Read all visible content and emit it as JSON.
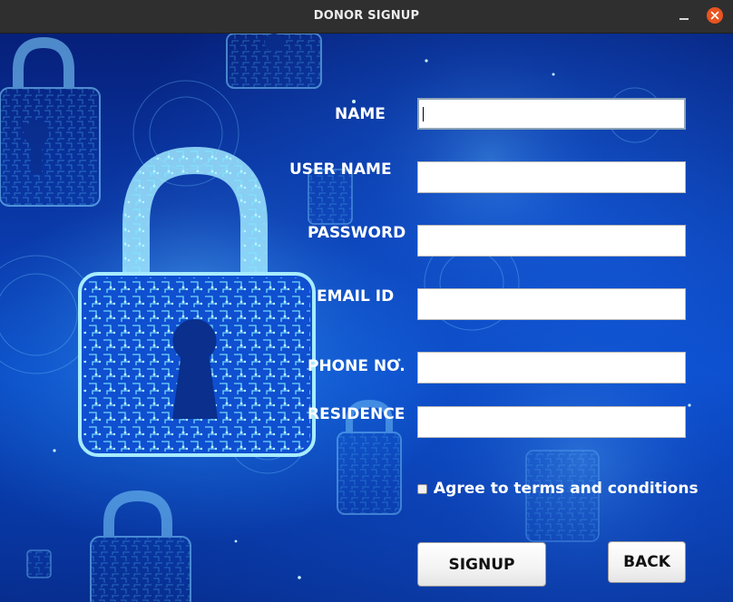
{
  "window": {
    "title": "DONOR SIGNUP"
  },
  "form": {
    "name_label": "NAME",
    "username_label": "USER NAME",
    "password_label": "PASSWORD",
    "email_label": "EMAIL ID",
    "phone_label": "PHONE NO.",
    "residence_label": "RESIDENCE",
    "name_value": "",
    "username_value": "",
    "password_value": "",
    "email_value": "",
    "phone_value": "",
    "residence_value": "",
    "agree_label": "Agree to terms and conditions",
    "agree_checked": false
  },
  "buttons": {
    "signup_label": "SIGNUP",
    "back_label": "BACK"
  },
  "colors": {
    "titlebar": "#2f2f2f",
    "close_button": "#e95420",
    "background_accent": "#0a3cb0"
  },
  "icons": {
    "background_art": "padlock-icon",
    "close": "close-icon",
    "minimize": "minimize-icon"
  }
}
